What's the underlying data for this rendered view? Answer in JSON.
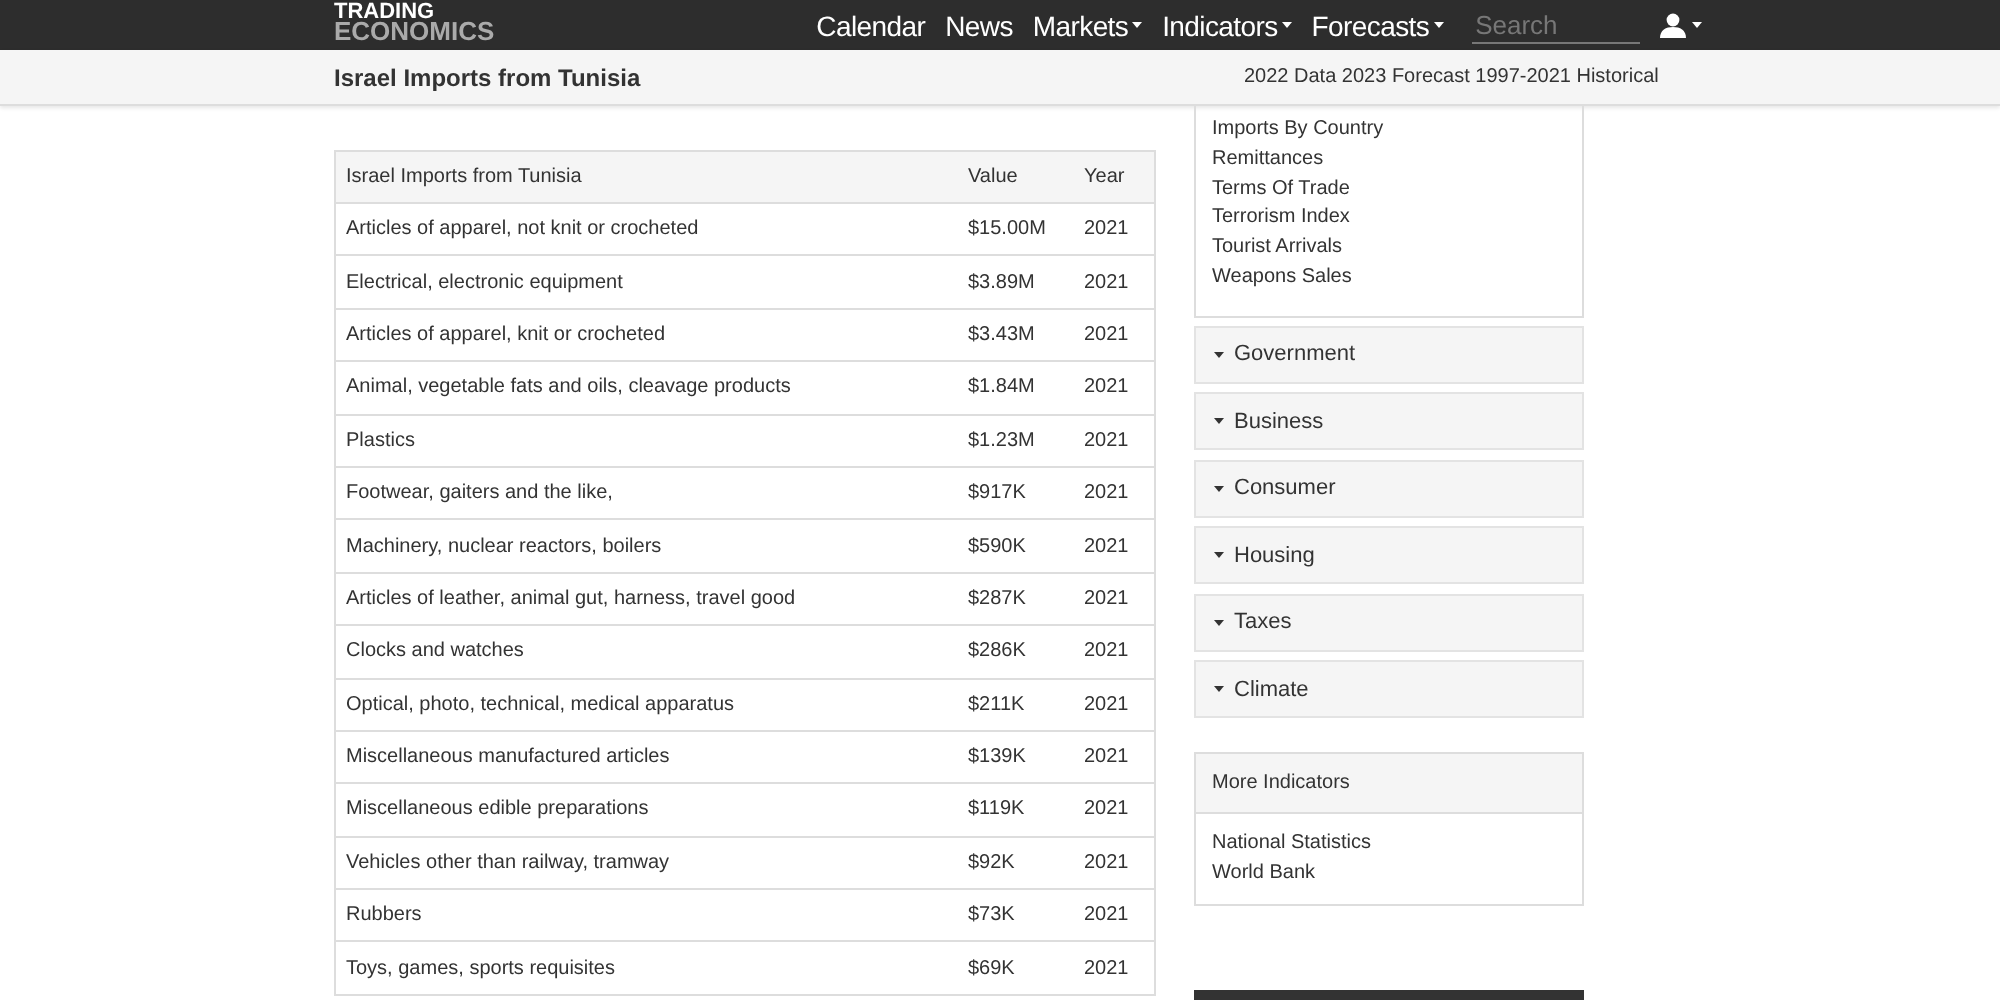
{
  "logo": {
    "line_1": "TRADING",
    "line_2": "ECONOMICS"
  },
  "nav": [
    {
      "label": "Calendar",
      "dropdown": false
    },
    {
      "label": "News",
      "dropdown": false
    },
    {
      "label": "Markets",
      "dropdown": true
    },
    {
      "label": "Indicators",
      "dropdown": true
    },
    {
      "label": "Forecasts",
      "dropdown": true
    }
  ],
  "search": {
    "placeholder": "Search"
  },
  "page_title": "Israel Imports from Tunisia",
  "subheader_links": "2022 Data 2023 Forecast 1997-2021 Historical",
  "table": {
    "columns": [
      "Israel Imports from Tunisia",
      "Value",
      "Year"
    ],
    "rows": [
      [
        "Articles of apparel, not knit or crocheted",
        "$15.00M",
        "2021"
      ],
      [
        "Electrical, electronic equipment",
        "$3.89M",
        "2021"
      ],
      [
        "Articles of apparel, knit or crocheted",
        "$3.43M",
        "2021"
      ],
      [
        "Animal, vegetable fats and oils, cleavage products",
        "$1.84M",
        "2021"
      ],
      [
        "Plastics",
        "$1.23M",
        "2021"
      ],
      [
        "Footwear, gaiters and the like,",
        "$917K",
        "2021"
      ],
      [
        "Machinery, nuclear reactors, boilers",
        "$590K",
        "2021"
      ],
      [
        "Articles of leather, animal gut, harness, travel good",
        "$287K",
        "2021"
      ],
      [
        "Clocks and watches",
        "$286K",
        "2021"
      ],
      [
        "Optical, photo, technical, medical apparatus",
        "$211K",
        "2021"
      ],
      [
        "Miscellaneous manufactured articles",
        "$139K",
        "2021"
      ],
      [
        "Miscellaneous edible preparations",
        "$119K",
        "2021"
      ],
      [
        "Vehicles other than railway, tramway",
        "$92K",
        "2021"
      ],
      [
        "Rubbers",
        "$73K",
        "2021"
      ],
      [
        "Toys, games, sports requisites",
        "$69K",
        "2021"
      ]
    ]
  },
  "sidebar": {
    "links": [
      "Imports By Country",
      "Remittances",
      "Terms Of Trade",
      "Terrorism Index",
      "Tourist Arrivals",
      "Weapons Sales"
    ],
    "sections": [
      {
        "label": "Government",
        "expanded": false
      },
      {
        "label": "Business",
        "expanded": false
      },
      {
        "label": "Consumer",
        "expanded": false
      },
      {
        "label": "Housing",
        "expanded": false
      },
      {
        "label": "Taxes",
        "expanded": false
      },
      {
        "label": "Climate",
        "expanded": false
      }
    ],
    "more_indicators": {
      "title": "More Indicators",
      "links": [
        "National Statistics",
        "World Bank"
      ]
    }
  }
}
